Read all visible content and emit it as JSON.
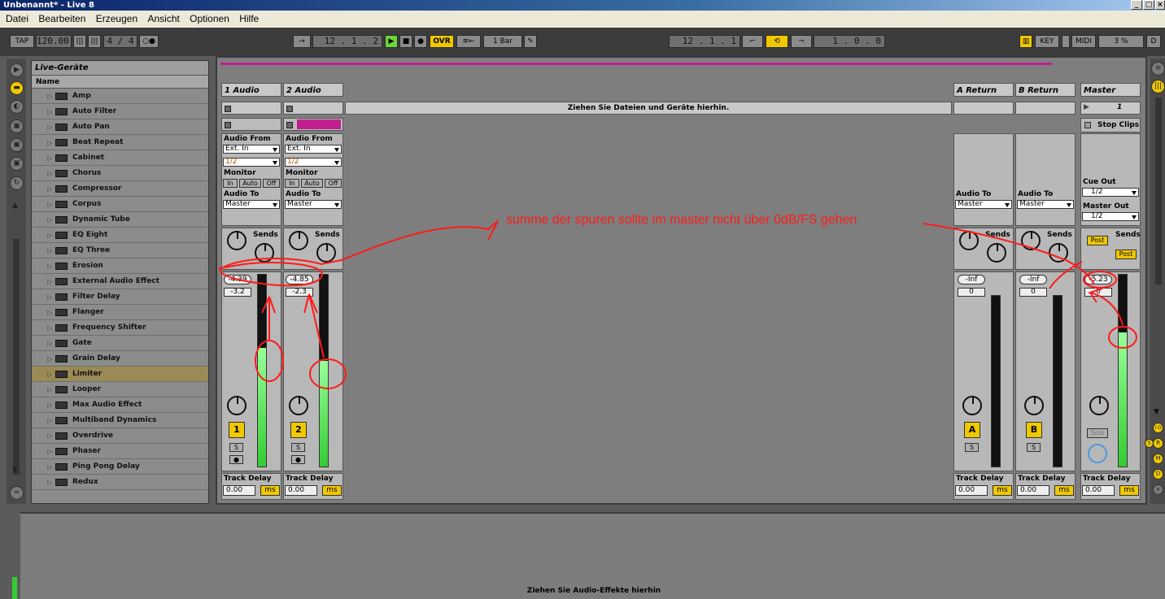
{
  "window": {
    "title": "Unbenannt* - Live 8"
  },
  "menu": [
    "Datei",
    "Bearbeiten",
    "Erzeugen",
    "Ansicht",
    "Optionen",
    "Hilfe"
  ],
  "control_bar": {
    "tap": "TAP",
    "tempo": "120.00",
    "signature": "4 / 4",
    "arrangement_position": "12 .  1 .  2",
    "ovr": "OVR",
    "quantize": "1 Bar",
    "loop_start": "12 .  1 .  1",
    "loop_length": "1 .  0 .  0",
    "key": "KEY",
    "midi": "MIDI",
    "cpu": "3 %",
    "disk": "D"
  },
  "browser": {
    "title": "Live-Geräte",
    "column": "Name",
    "items": [
      "Amp",
      "Auto Filter",
      "Auto Pan",
      "Beat Repeat",
      "Cabinet",
      "Chorus",
      "Compressor",
      "Corpus",
      "Dynamic Tube",
      "EQ Eight",
      "EQ Three",
      "Erosion",
      "External Audio Effect",
      "Filter Delay",
      "Flanger",
      "Frequency Shifter",
      "Gate",
      "Grain Delay",
      "Limiter",
      "Looper",
      "Max Audio Effect",
      "Multiband Dynamics",
      "Overdrive",
      "Phaser",
      "Ping Pong Delay",
      "Redux"
    ],
    "selected": "Limiter"
  },
  "session": {
    "drop_hint": "Ziehen Sie Dateien und Geräte hierhin.",
    "labels": {
      "audio_from": "Audio From",
      "monitor": "Monitor",
      "audio_to": "Audio To",
      "sends": "Sends",
      "track_delay": "Track Delay",
      "ms": "ms",
      "in": "In",
      "auto": "Auto",
      "off": "Off",
      "cue_out": "Cue Out",
      "master_out": "Master Out",
      "stop_clips": "Stop Clips",
      "post": "Post",
      "send_a": "A",
      "send_b": "B",
      "solo_short": "S",
      "solo": "Solo"
    },
    "tracks": [
      {
        "name": "1 Audio",
        "input": "Ext. In",
        "channel": "1/2",
        "output": "Master",
        "volume": "-4.39",
        "pan": "-3.2",
        "number": "1",
        "delay": "0.00",
        "meter": 0.62
      },
      {
        "name": "2 Audio",
        "input": "Ext. In",
        "channel": "1/2",
        "output": "Master",
        "volume": "-4.85",
        "pan": "-2.3",
        "number": "2",
        "delay": "0.00",
        "meter": 0.55
      }
    ],
    "returns": [
      {
        "name": "A Return",
        "output": "Master",
        "volume": "-Inf",
        "pan": "0",
        "letter": "A",
        "delay": "0.00"
      },
      {
        "name": "B Return",
        "output": "Master",
        "volume": "-Inf",
        "pan": "0",
        "letter": "B",
        "delay": "0.00"
      }
    ],
    "master": {
      "name": "Master",
      "scene": "1",
      "cue_out": "1/2",
      "master_out": "1/2",
      "volume": "-5.23",
      "pan": "0",
      "delay": "0.00",
      "meter": 0.7
    }
  },
  "detail": {
    "drop_hint": "Ziehen Sie Audio-Effekte hierhin"
  },
  "annotation": {
    "text": "summe der spuren sollte im master nicht über 0dB/FS gehen",
    "color": "#ff1a1a"
  }
}
